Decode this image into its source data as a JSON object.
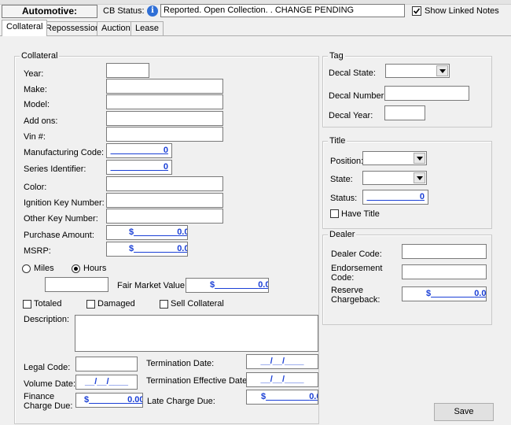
{
  "header": {
    "title": "Automotive:",
    "cb_status_label": "CB Status:",
    "cb_status_value": "Reported. Open Collection. . CHANGE PENDING",
    "show_linked_notes": "Show Linked Notes"
  },
  "tabs": [
    {
      "label": "Collateral"
    },
    {
      "label": "Repossession"
    },
    {
      "label": "Auction"
    },
    {
      "label": "Lease"
    }
  ],
  "collateral": {
    "group_title": "Collateral",
    "year": "Year:",
    "make": "Make:",
    "model": "Model:",
    "add_ons": "Add ons:",
    "vin": "Vin #:",
    "manufacturing_code": "Manufacturing Code:",
    "manufacturing_code_value": "0",
    "series_identifier": "Series Identifier:",
    "series_identifier_value": "0",
    "color": "Color:",
    "ignition_key": "Ignition Key Number:",
    "other_key": "Other Key Number:",
    "purchase_amount": "Purchase Amount:",
    "purchase_amount_value": "0.00",
    "msrp": "MSRP:",
    "msrp_value": "0.00",
    "miles": "Miles",
    "hours": "Hours",
    "fair_market_value": "Fair Market Value:",
    "fair_market_value_value": "0.00",
    "totaled": "Totaled",
    "damaged": "Damaged",
    "sell_collateral": "Sell Collateral",
    "description": "Description:",
    "legal_code": "Legal Code:",
    "termination_date": "Termination Date:",
    "volume_date": "Volume Date:",
    "termination_effective_date": "Termination Effective Date:",
    "finance_charge_due_1": "Finance",
    "finance_charge_due_2": "Charge Due:",
    "finance_charge_due_value": "0.00",
    "late_charge_due": "Late Charge Due:",
    "late_charge_due_value": "0.00",
    "date_placeholder": "__/__/____",
    "currency": "$"
  },
  "tag": {
    "group_title": "Tag",
    "decal_state": "Decal State:",
    "decal_number": "Decal Number:",
    "decal_year": "Decal Year:"
  },
  "title": {
    "group_title": "Title",
    "position": "Position:",
    "state": "State:",
    "status": "Status:",
    "status_value": "0",
    "have_title": "Have Title"
  },
  "dealer": {
    "group_title": "Dealer",
    "dealer_code": "Dealer Code:",
    "endorsement_code_1": "Endorsement",
    "endorsement_code_2": "Code:",
    "reserve_chargeback_1": "Reserve",
    "reserve_chargeback_2": "Chargeback:",
    "reserve_chargeback_value": "0.00"
  },
  "actions": {
    "save": "Save"
  }
}
